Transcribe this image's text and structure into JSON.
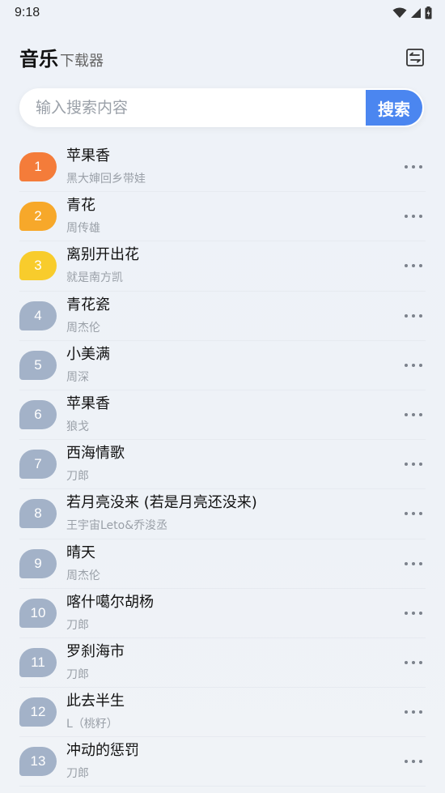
{
  "status_bar": {
    "time": "9:18"
  },
  "header": {
    "title_main": "音乐",
    "title_sub": "下载器",
    "menu_icon": "swap-list-icon"
  },
  "search": {
    "placeholder": "输入搜索内容",
    "value": "",
    "button_label": "搜索"
  },
  "colors": {
    "rank_1": "#f47c3a",
    "rank_2": "#f7a82a",
    "rank_3": "#f8cc2c",
    "rank_default": "#a3b2c8",
    "search_button": "#4b86f0"
  },
  "songs": [
    {
      "rank": "1",
      "title": "苹果香",
      "artist": "黑大婶回乡带娃"
    },
    {
      "rank": "2",
      "title": "青花",
      "artist": "周传雄"
    },
    {
      "rank": "3",
      "title": "离别开出花",
      "artist": "就是南方凯"
    },
    {
      "rank": "4",
      "title": "青花瓷",
      "artist": "周杰伦"
    },
    {
      "rank": "5",
      "title": "小美满",
      "artist": "周深"
    },
    {
      "rank": "6",
      "title": "苹果香",
      "artist": "狼戈"
    },
    {
      "rank": "7",
      "title": "西海情歌",
      "artist": "刀郎"
    },
    {
      "rank": "8",
      "title": "若月亮没来 (若是月亮还没来)",
      "artist": "王宇宙Leto&乔浚丞"
    },
    {
      "rank": "9",
      "title": "晴天",
      "artist": "周杰伦"
    },
    {
      "rank": "10",
      "title": "喀什噶尔胡杨",
      "artist": "刀郎"
    },
    {
      "rank": "11",
      "title": "罗刹海市",
      "artist": "刀郎"
    },
    {
      "rank": "12",
      "title": "此去半生",
      "artist": "L（桃籽）"
    },
    {
      "rank": "13",
      "title": "冲动的惩罚",
      "artist": "刀郎"
    }
  ]
}
